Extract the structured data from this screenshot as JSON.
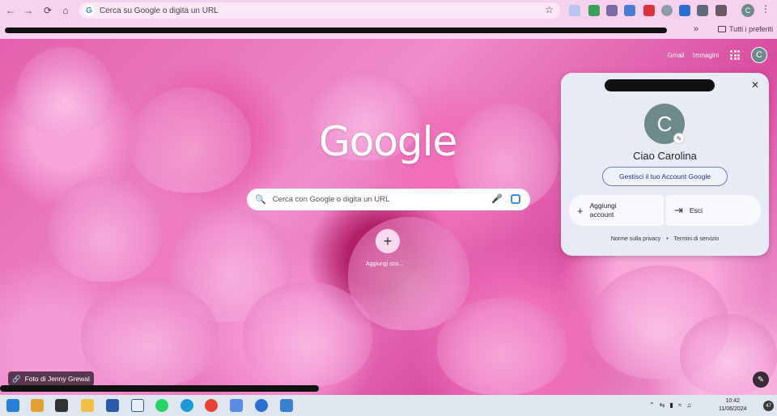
{
  "browser": {
    "omnibox_placeholder": "Cerca su Google o digita un URL",
    "bookmarks_more": "»",
    "bookmarks_folder": "Tutti i preferiti",
    "profile_initial": "C"
  },
  "newtab": {
    "links": [
      "Gmail",
      "Immagini"
    ],
    "logo": "Google",
    "search_placeholder": "Cerca con Google o digita un URL",
    "shortcut_label": "Aggiungi sco...",
    "photo_credit": "Foto di Jenny Grewal",
    "avatar_initial": "C"
  },
  "account_card": {
    "avatar_initial": "C",
    "greeting": "Ciao Carolina",
    "manage_button": "Gestisci il tuo Account Google",
    "add_account": "Aggiungi account",
    "sign_out": "Esci",
    "privacy": "Norme sulla privacy",
    "separator": "•",
    "terms": "Termini di servizio"
  },
  "taskbar": {
    "time": "10:42",
    "date": "11/06/2024",
    "notifications": "47"
  },
  "colors": {
    "toolbar": "#f6d2ee",
    "card": "#e8ebf5",
    "avatar": "#6f8a8a"
  }
}
